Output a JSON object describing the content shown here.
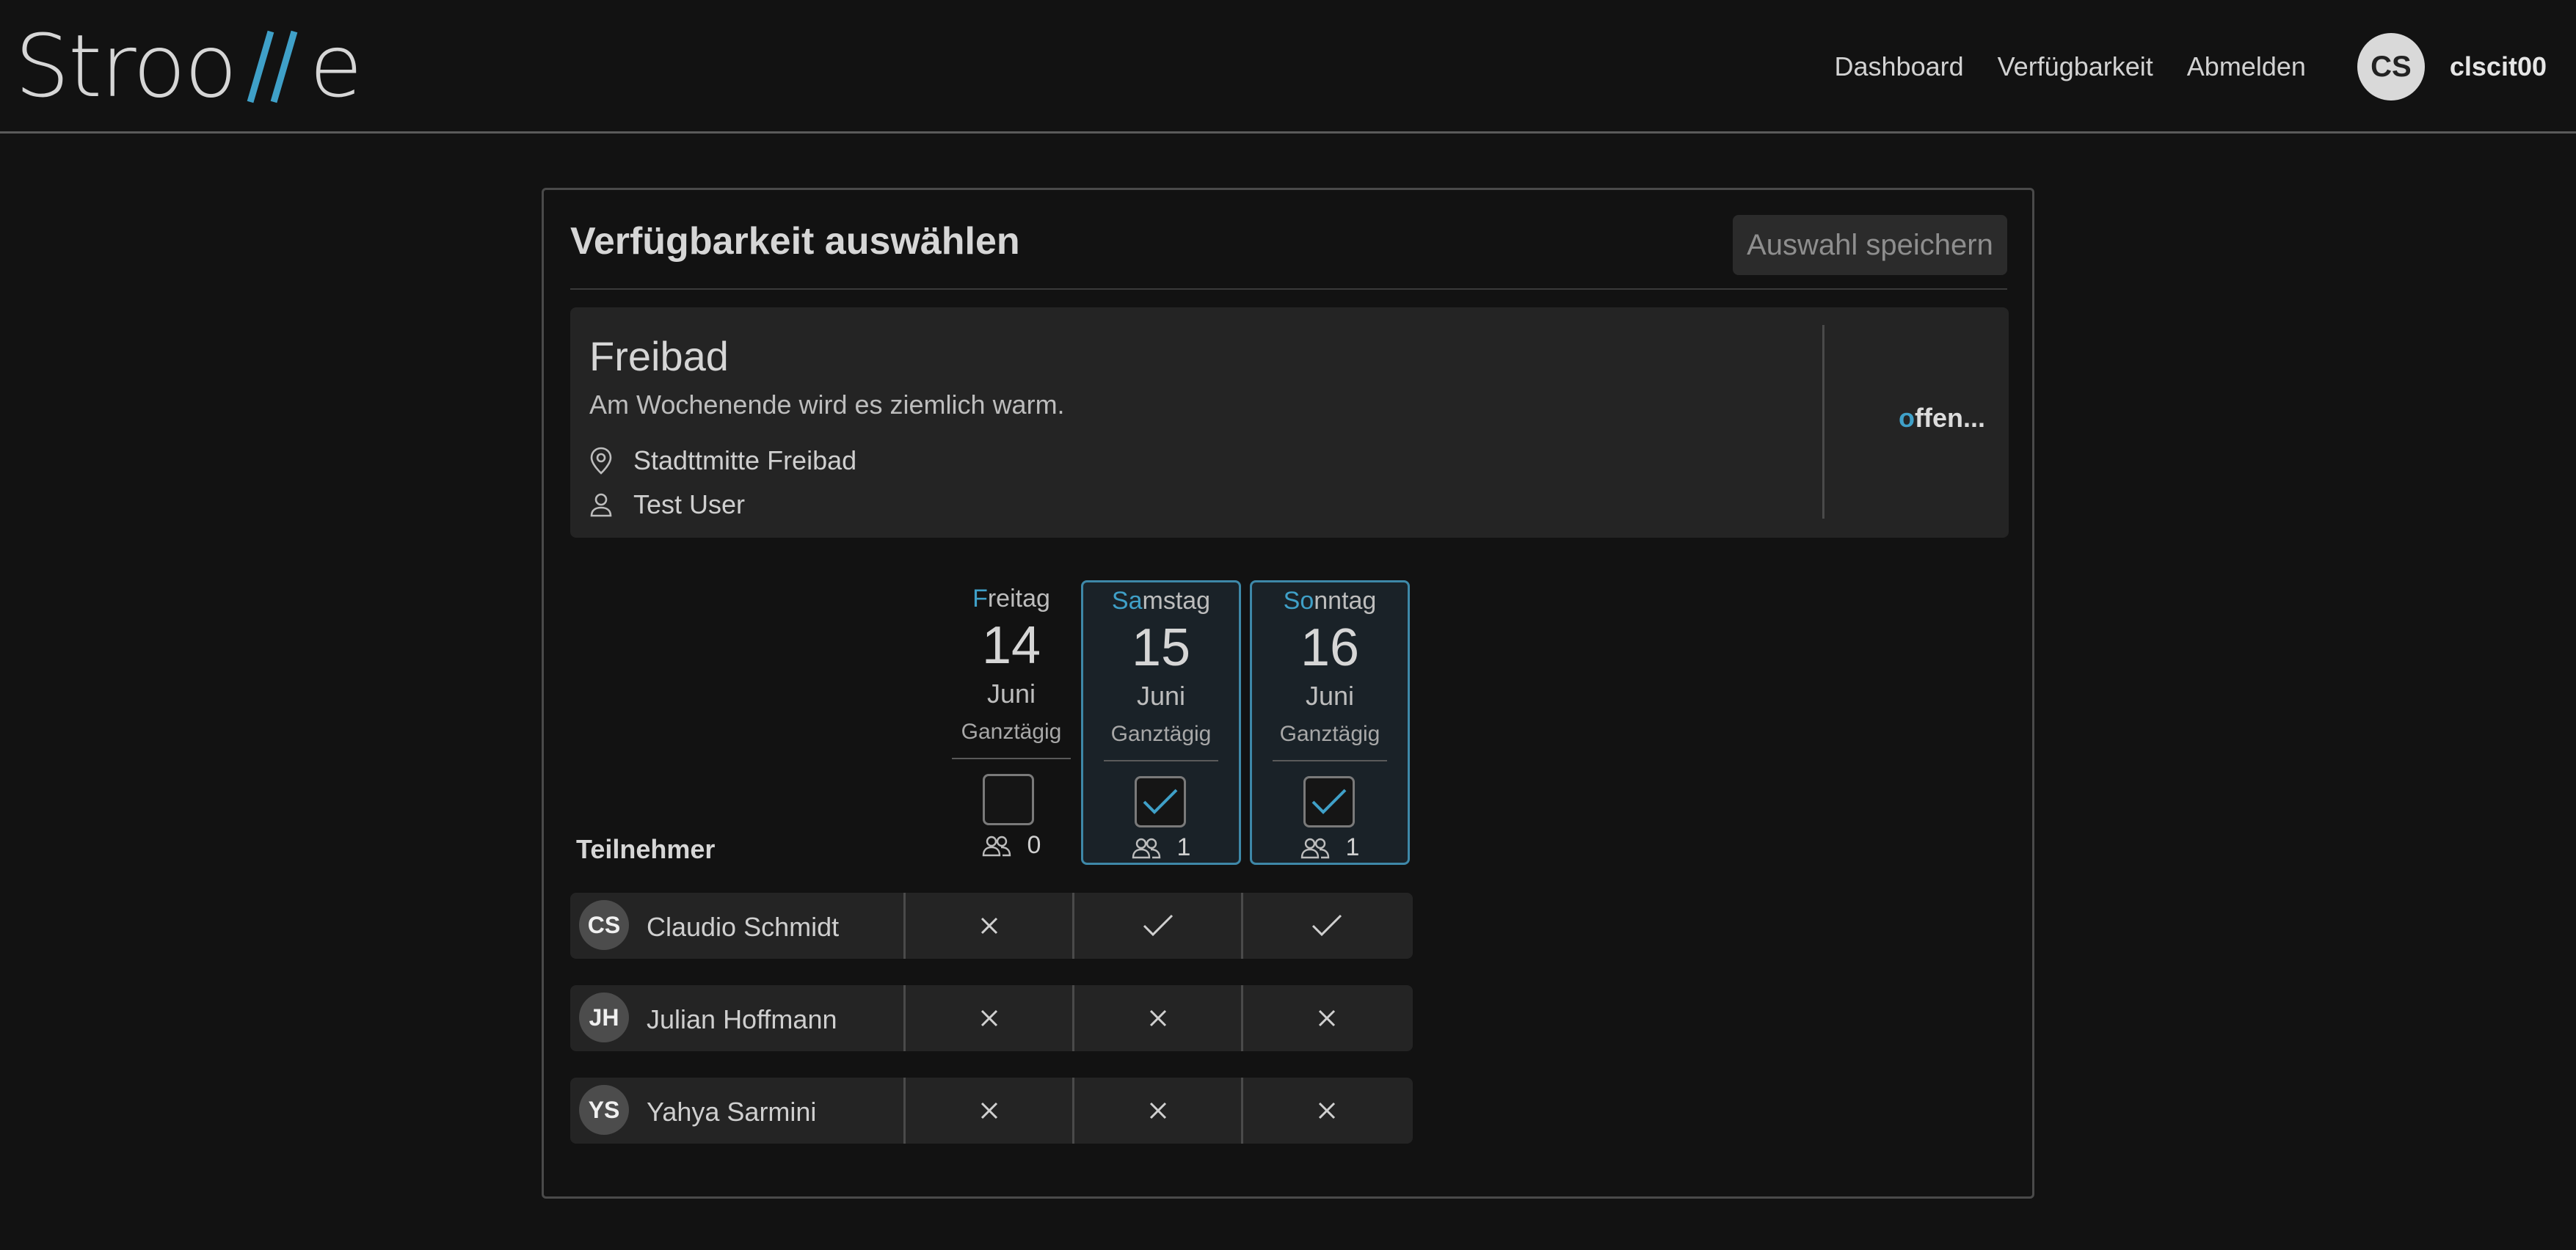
{
  "app": {
    "logo": {
      "left": "Stroo",
      "right": "e"
    }
  },
  "nav": {
    "items": [
      "Dashboard",
      "Verfügbarkeit",
      "Abmelden"
    ],
    "user_initials": "CS",
    "username": "clscit00"
  },
  "page": {
    "title": "Verfügbarkeit auswählen",
    "save_label": "Auswahl speichern"
  },
  "event": {
    "name": "Freibad",
    "description": "Am Wochenende wird es ziemlich warm.",
    "location": "Stadttmitte Freibad",
    "organizer": "Test User",
    "status_accent": "o",
    "status_rest": "ffen..."
  },
  "participants_label": "Teilnehmer",
  "days": [
    {
      "wd_accent": "F",
      "wd_rest": "reitag",
      "num": "14",
      "month": "Juni",
      "allday": "Ganztägig",
      "checked": false,
      "count": "0",
      "selected": false
    },
    {
      "wd_accent": "Sa",
      "wd_rest": "mstag",
      "num": "15",
      "month": "Juni",
      "allday": "Ganztägig",
      "checked": true,
      "count": "1",
      "selected": true
    },
    {
      "wd_accent": "So",
      "wd_rest": "nntag",
      "num": "16",
      "month": "Juni",
      "allday": "Ganztägig",
      "checked": true,
      "count": "1",
      "selected": true
    }
  ],
  "participants": [
    {
      "initials": "CS",
      "name": "Claudio Schmidt",
      "votes": [
        "no",
        "yes",
        "yes"
      ]
    },
    {
      "initials": "JH",
      "name": "Julian Hoffmann",
      "votes": [
        "no",
        "no",
        "no"
      ]
    },
    {
      "initials": "YS",
      "name": "Yahya Sarmini",
      "votes": [
        "no",
        "no",
        "no"
      ]
    }
  ],
  "colors": {
    "background": "#121212",
    "accent": "#3fa0c8",
    "panel": "#242424"
  }
}
